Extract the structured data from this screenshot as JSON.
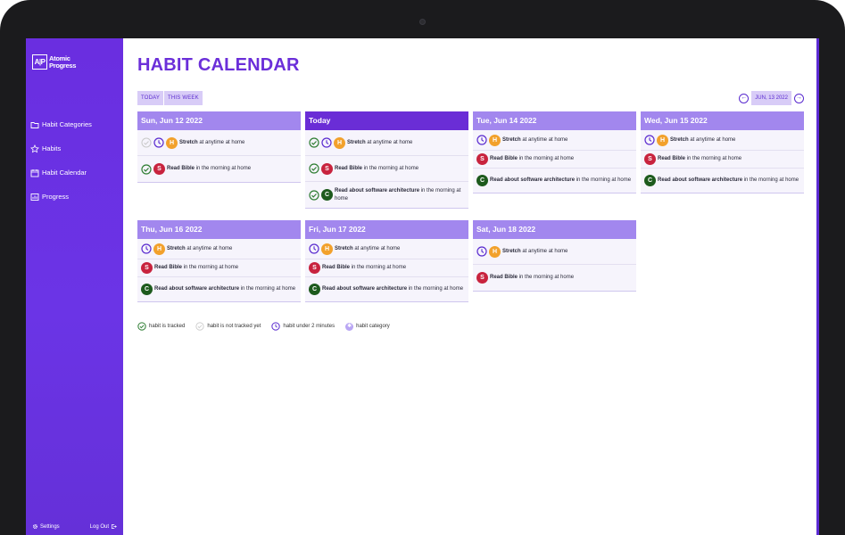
{
  "logo": {
    "mark": "A|P",
    "line1": "Atomic",
    "line2": "Progress"
  },
  "sidebar": {
    "items": [
      {
        "label": "Habit Categories",
        "icon": "folder-icon"
      },
      {
        "label": "Habits",
        "icon": "star-icon"
      },
      {
        "label": "Habit Calendar",
        "icon": "calendar-icon"
      },
      {
        "label": "Progress",
        "icon": "chart-icon"
      }
    ],
    "settings_label": "Settings",
    "logout_label": "Log Out"
  },
  "page": {
    "title": "HABIT CALENDAR"
  },
  "toolbar": {
    "today_label": "TODAY",
    "this_week_label": "THIS WEEK",
    "date_label": "JUN, 13 2022",
    "prev_icon": "arrow-left-circle-icon",
    "next_icon": "arrow-right-circle-icon"
  },
  "days": [
    {
      "title": "Sun, Jun 12 2022",
      "habits": [
        {
          "avatar": "H",
          "name": "Stretch",
          "detail": "at anytime at home",
          "status": "untracked",
          "under2": true
        },
        {
          "avatar": "S",
          "name": "Read Bible",
          "detail": "in the morning at home",
          "status": "tracked",
          "under2": false
        }
      ]
    },
    {
      "title": "Today",
      "habits": [
        {
          "avatar": "H",
          "name": "Stretch",
          "detail": "at anytime at home",
          "status": "tracked",
          "under2": true
        },
        {
          "avatar": "S",
          "name": "Read Bible",
          "detail": "in the morning at home",
          "status": "tracked",
          "under2": false
        },
        {
          "avatar": "C",
          "name": "Read about software architecture",
          "detail": "in the morning at home",
          "status": "tracked",
          "under2": false
        }
      ]
    },
    {
      "title": "Tue, Jun 14 2022",
      "habits": [
        {
          "avatar": "H",
          "name": "Stretch",
          "detail": "at anytime at home",
          "status": "none",
          "under2": true
        },
        {
          "avatar": "S",
          "name": "Read Bible",
          "detail": "in the morning at home",
          "status": "none",
          "under2": false
        },
        {
          "avatar": "C",
          "name": "Read about software architecture",
          "detail": "in the morning at home",
          "status": "none",
          "under2": false
        }
      ]
    },
    {
      "title": "Wed, Jun 15 2022",
      "habits": [
        {
          "avatar": "H",
          "name": "Stretch",
          "detail": "at anytime at home",
          "status": "none",
          "under2": true
        },
        {
          "avatar": "S",
          "name": "Read Bible",
          "detail": "in the morning at home",
          "status": "none",
          "under2": false
        },
        {
          "avatar": "C",
          "name": "Read about software architecture",
          "detail": "in the morning at home",
          "status": "none",
          "under2": false
        }
      ]
    },
    {
      "title": "Thu, Jun 16 2022",
      "habits": [
        {
          "avatar": "H",
          "name": "Stretch",
          "detail": "at anytime at home",
          "status": "none",
          "under2": true
        },
        {
          "avatar": "S",
          "name": "Read Bible",
          "detail": "in the morning at home",
          "status": "none",
          "under2": false
        },
        {
          "avatar": "C",
          "name": "Read about software architecture",
          "detail": "in the morning at home",
          "status": "none",
          "under2": false
        }
      ]
    },
    {
      "title": "Fri, Jun 17 2022",
      "habits": [
        {
          "avatar": "H",
          "name": "Stretch",
          "detail": "at anytime at home",
          "status": "none",
          "under2": true
        },
        {
          "avatar": "S",
          "name": "Read Bible",
          "detail": "in the morning at home",
          "status": "none",
          "under2": false
        },
        {
          "avatar": "C",
          "name": "Read about software architecture",
          "detail": "in the morning at home",
          "status": "none",
          "under2": false
        }
      ]
    },
    {
      "title": "Sat, Jun 18 2022",
      "habits": [
        {
          "avatar": "H",
          "name": "Stretch",
          "detail": "at anytime at home",
          "status": "none",
          "under2": true
        },
        {
          "avatar": "S",
          "name": "Read Bible",
          "detail": "in the morning at home",
          "status": "none",
          "under2": false
        }
      ]
    }
  ],
  "legend": [
    {
      "label": "habit is tracked",
      "icon": "check-circle-icon"
    },
    {
      "label": "habit is not tracked yet",
      "icon": "check-circle-outline-icon"
    },
    {
      "label": "habit under 2 minutes",
      "icon": "clock-icon"
    },
    {
      "label": "habit category",
      "icon": "category-dot-icon"
    }
  ],
  "colors": {
    "brand": "#6b2fd9",
    "header": "#a287ee",
    "today": "#6a2dd6",
    "tracked": "#2e7d32",
    "habit_h": "#f2a12c",
    "habit_s": "#c8233e",
    "habit_c": "#1d5a1d"
  }
}
